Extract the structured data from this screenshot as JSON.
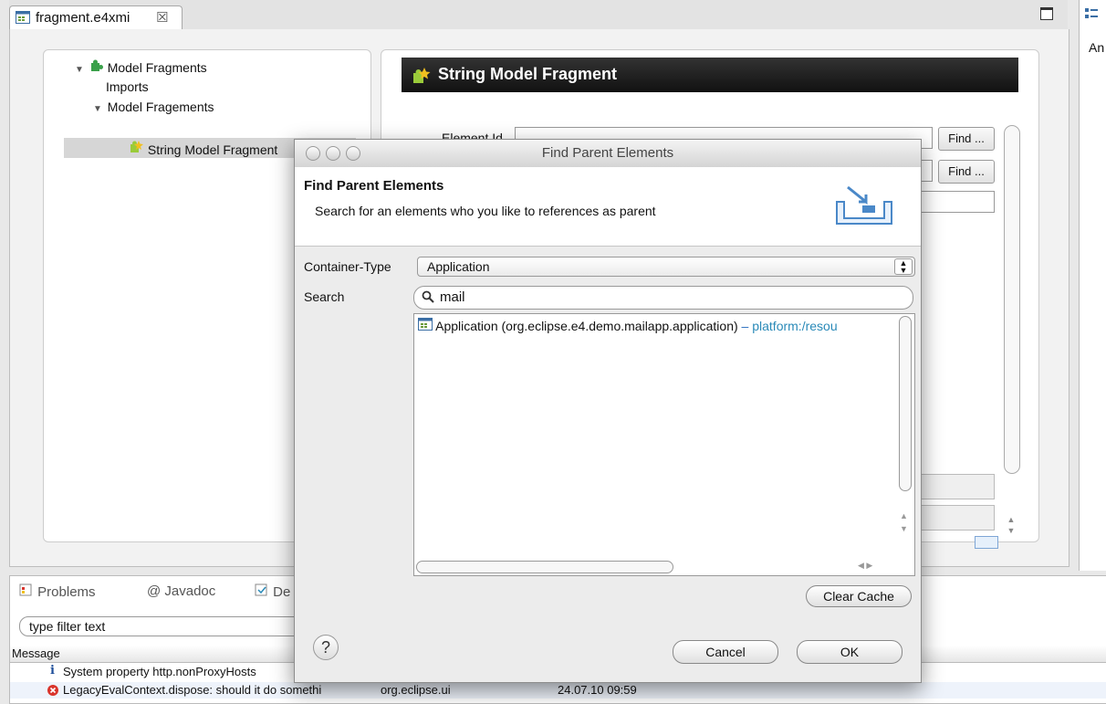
{
  "editor": {
    "tab_label": "fragment.e4xmi",
    "tab_close": "☒",
    "tree": {
      "root": "Model Fragments",
      "imports": "Imports",
      "model_fragements": "Model Fragements",
      "string_fragment": "String Model Fragment"
    },
    "detail": {
      "header": "String Model Fragment",
      "element_id_label": "Element Id",
      "find_label_1": "Find ...",
      "find_label_2": "Find ..."
    }
  },
  "outline": {
    "label": "An"
  },
  "bottom": {
    "tabs": [
      "Problems",
      "@ Javadoc",
      "De"
    ],
    "filter_placeholder": "type filter text",
    "column_message": "Message",
    "rows": [
      {
        "icon": "info-icon",
        "message": "System property http.nonProxyHosts",
        "plugin": "",
        "date": ""
      },
      {
        "icon": "error-icon",
        "message": "LegacyEvalContext.dispose: should it do somethi",
        "plugin": "org.eclipse.ui",
        "date": "24.07.10 09:59"
      }
    ]
  },
  "dialog": {
    "title": "Find Parent Elements",
    "banner_title": "Find Parent Elements",
    "banner_description": "Search for an elements who you like to references as parent",
    "container_type_label": "Container-Type",
    "container_type_value": "Application",
    "search_label": "Search",
    "search_value": "mail",
    "result": {
      "name": "Application (org.eclipse.e4.demo.mailapp.application)",
      "separator": "–",
      "location": "platform:/resou"
    },
    "clear_cache_label": "Clear Cache",
    "cancel_label": "Cancel",
    "ok_label": "OK",
    "help_label": "?"
  },
  "colors": {
    "accent_link": "#2a8ab8",
    "header_bg": "#111111",
    "error": "#d9342b"
  }
}
